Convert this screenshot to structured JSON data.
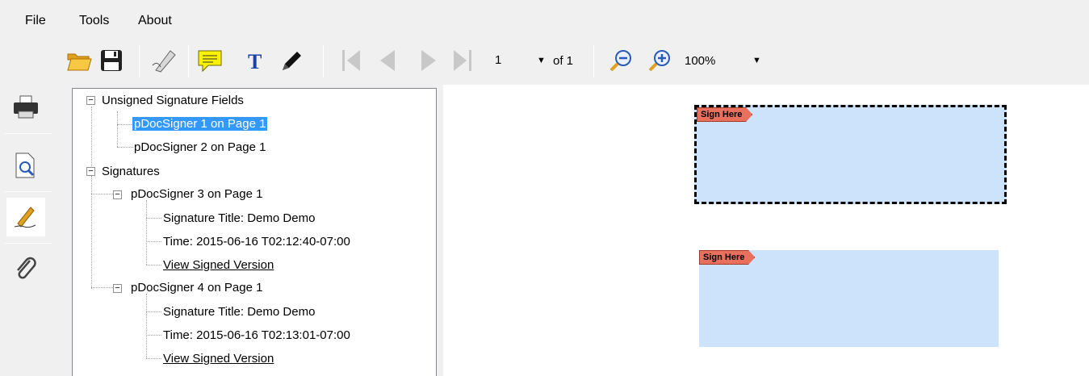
{
  "menu": {
    "items": [
      {
        "label": "File"
      },
      {
        "label": "Tools"
      },
      {
        "label": "About"
      }
    ]
  },
  "toolbar": {
    "page_number": "1",
    "page_of": "of 1",
    "zoom": "100%",
    "icons": [
      "open-folder-icon",
      "save-icon",
      "sign-pen-icon",
      "comment-icon",
      "text-tool-icon",
      "pen-tool-icon",
      "first-page-icon",
      "previous-page-icon",
      "next-page-icon",
      "last-page-icon",
      "zoom-out-icon",
      "zoom-in-icon"
    ]
  },
  "leftbar": {
    "icons": [
      "printer-icon",
      "document-search-icon",
      "signature-pen-icon",
      "attachment-icon"
    ]
  },
  "tree": {
    "unsigned_group": "Unsigned Signature Fields",
    "unsigned": [
      {
        "label": "pDocSigner 1 on Page 1",
        "selected": true
      },
      {
        "label": "pDocSigner 2 on Page 1",
        "selected": false
      }
    ],
    "signatures_group": "Signatures",
    "signatures": [
      {
        "label": "pDocSigner 3 on Page 1",
        "title": "Signature Title: Demo Demo",
        "time": "Time: 2015-06-16 T02:12:40-07:00",
        "link": "View Signed Version"
      },
      {
        "label": "pDocSigner 4 on Page 1",
        "title": "Signature Title: Demo Demo",
        "time": "Time: 2015-06-16 T02:13:01-07:00",
        "link": "View Signed Version"
      }
    ]
  },
  "document": {
    "fields": [
      {
        "tag": "Sign Here",
        "focused": true
      },
      {
        "tag": "Sign Here",
        "focused": false
      }
    ]
  },
  "colors": {
    "selection": "#3399ff",
    "field_fill": "#cce3fb",
    "tag_fill": "#e8705c",
    "comment_yellow": "#fff200",
    "tool_blue": "#1f3fa8"
  }
}
